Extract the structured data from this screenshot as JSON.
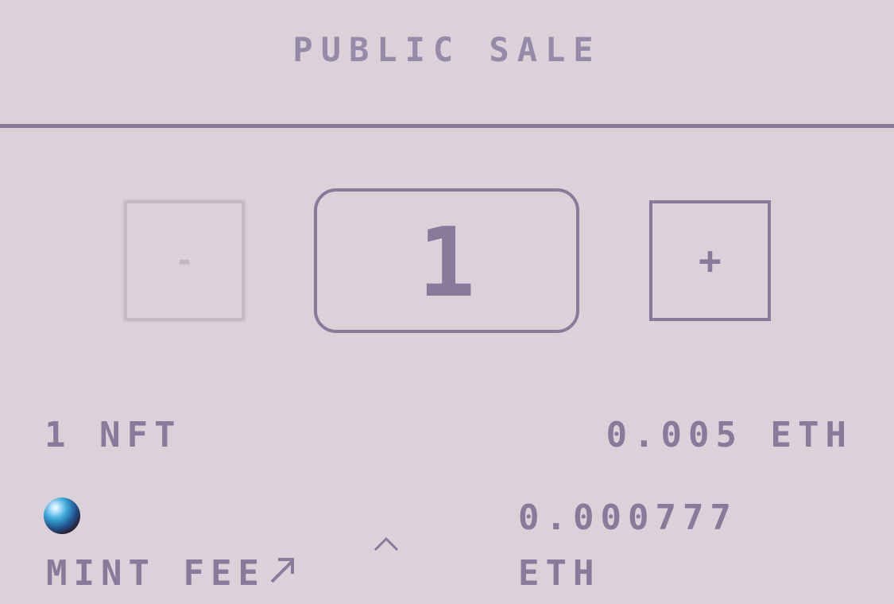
{
  "header": {
    "title": "PUBLIC SALE"
  },
  "stepper": {
    "decrement_label": "-",
    "increment_label": "+",
    "quantity": "1"
  },
  "summary": {
    "nft_count": "1 NFT",
    "price": "0.005 ETH"
  },
  "fee": {
    "label": "MINT FEE",
    "value": "0.000777",
    "unit": "ETH",
    "icon": "arrow-up-right-icon"
  },
  "colors": {
    "background": "#dcd1d8",
    "accent": "#877a9b",
    "disabled": "#c6bac8"
  }
}
